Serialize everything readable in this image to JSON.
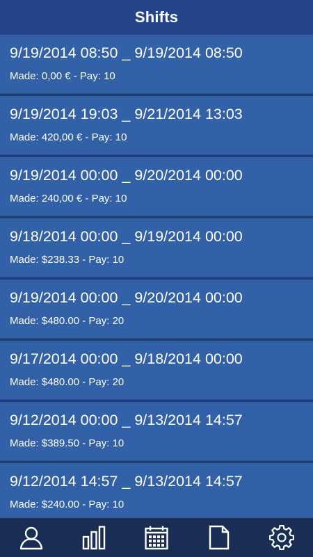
{
  "header": {
    "title": "Shifts"
  },
  "shifts": [
    {
      "range": "9/19/2014 08:50 _ 9/19/2014 08:50",
      "made": "Made: 0,00 € - Pay: 10"
    },
    {
      "range": "9/19/2014 19:03 _ 9/21/2014 13:03",
      "made": "Made: 420,00 € - Pay: 10"
    },
    {
      "range": "9/19/2014 00:00 _ 9/20/2014 00:00",
      "made": "Made: 240,00 € - Pay: 10"
    },
    {
      "range": "9/18/2014 00:00 _ 9/19/2014 00:00",
      "made": "Made: $238.33 - Pay: 10"
    },
    {
      "range": "9/19/2014 00:00 _ 9/20/2014 00:00",
      "made": "Made: $480.00 - Pay: 20"
    },
    {
      "range": "9/17/2014 00:00 _ 9/18/2014 00:00",
      "made": "Made: $480.00 - Pay: 20"
    },
    {
      "range": "9/12/2014 00:00 _ 9/13/2014 14:57",
      "made": "Made: $389.50 - Pay: 10"
    },
    {
      "range": "9/12/2014 14:57 _ 9/13/2014 14:57",
      "made": "Made: $240.00 - Pay: 10"
    }
  ],
  "nav": [
    {
      "icon": "profile-icon"
    },
    {
      "icon": "bar-chart-icon"
    },
    {
      "icon": "calendar-icon"
    },
    {
      "icon": "document-icon"
    },
    {
      "icon": "gear-icon"
    }
  ],
  "colors": {
    "header_bg": "#24458c",
    "item_bg": "#3361a8",
    "nav_bg": "#1a2e55",
    "text": "#ffffff"
  }
}
